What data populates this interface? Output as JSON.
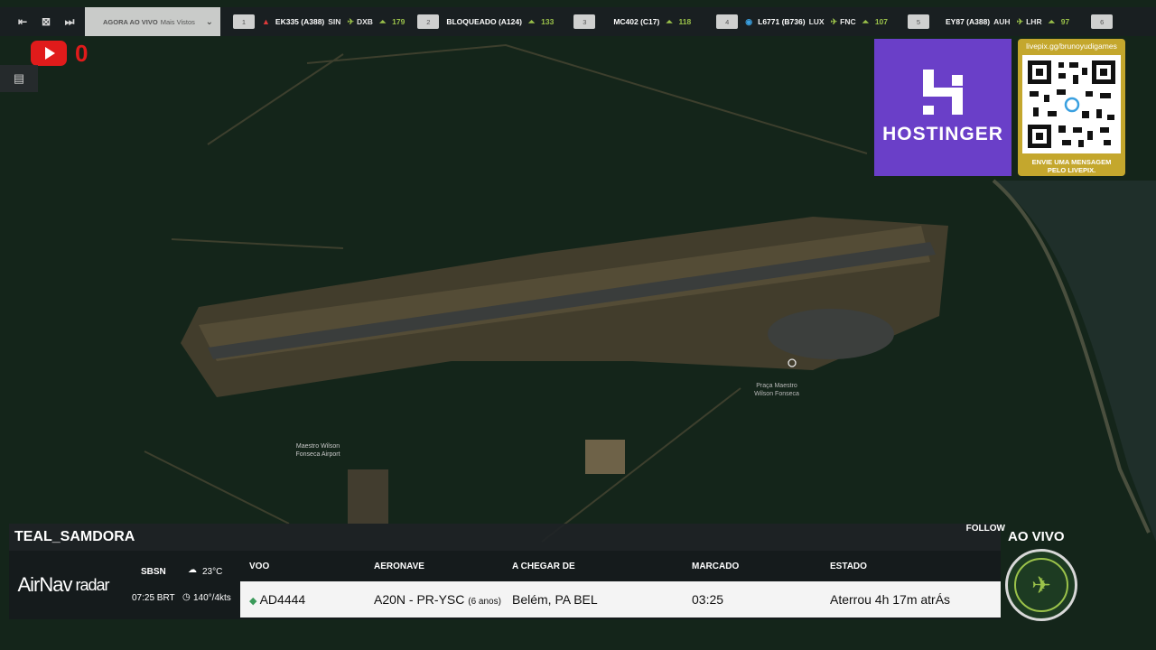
{
  "topbar": {
    "live_tab": {
      "prefix": "AGORA AO VIVO",
      "label": "Mais Vistos"
    },
    "flights": [
      {
        "num": "1",
        "id": "EK335 (A388)",
        "from": "SIN",
        "to": "DXB",
        "alt": "179",
        "icon_color": "#e03a3a"
      },
      {
        "num": "2",
        "id": "BLOQUEADO (A124)",
        "from": "",
        "to": "",
        "alt": "133",
        "icon_color": ""
      },
      {
        "num": "3",
        "id": "MC402 (C17)",
        "from": "",
        "to": "",
        "alt": "118",
        "icon_color": ""
      },
      {
        "num": "4",
        "id": "L6771 (B736)",
        "from": "LUX",
        "to": "FNC",
        "alt": "107",
        "icon_color": "#3aa0e0"
      },
      {
        "num": "5",
        "id": "EY87 (A388)",
        "from": "AUH",
        "to": "LHR",
        "alt": "97",
        "icon_color": ""
      }
    ],
    "last_num": "6"
  },
  "youtube": {
    "count": "0"
  },
  "map": {
    "airport_label_1": "Maestro Wilson",
    "airport_label_2": "Fonseca Airport",
    "pin_label_1": "Praça Maestro",
    "pin_label_2": "Wilson Fonseca"
  },
  "sponsor": {
    "brand": "HOSTINGER",
    "livepix_url": "livepix.gg/brunoyudigames",
    "livepix_msg_1": "ENVIE UMA MENSAGEM",
    "livepix_msg_2": "PELO LIVEPIX."
  },
  "panel": {
    "user": "TEAL_SAMDORA",
    "follow": "FOLLOW",
    "brand_1": "AirNav",
    "brand_2": "radar",
    "icao": "SBSN",
    "time": "07:25 BRT",
    "temp": "23°C",
    "wind": "140°/4kts",
    "headers": {
      "voo": "VOO",
      "aeronave": "AERONAVE",
      "origem": "A CHEGAR DE",
      "marcado": "MARCADO",
      "estado": "ESTADO"
    },
    "row": {
      "voo": "AD4444",
      "aeronave": "A20N - PR-YSC",
      "idade": "(6 anos)",
      "origem": "Belém, PA BEL",
      "marcado": "03:25",
      "estado": "Aterrou 4h 17m atrÁs"
    }
  },
  "live_label": "AO VIVO"
}
